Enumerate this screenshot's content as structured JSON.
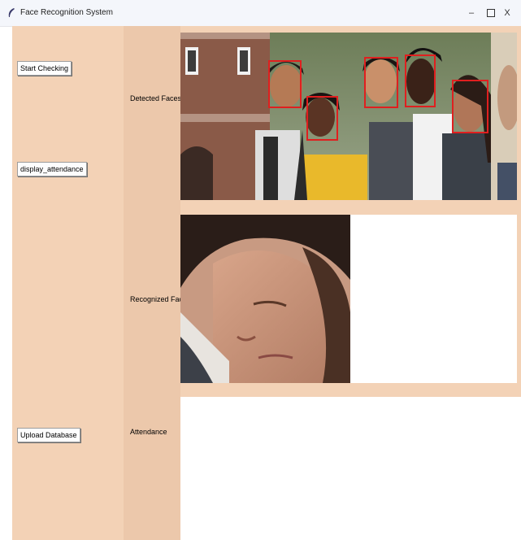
{
  "window": {
    "title": "Face Recognition System",
    "icon": "feather-icon",
    "controls": {
      "minimize_label": "–",
      "close_label": "X"
    }
  },
  "left_panel": {
    "buttons": {
      "start_checking": "Start Checking",
      "display_attendance": "display_attendance",
      "upload_database": "Upload Database"
    }
  },
  "mid_panel": {
    "labels": {
      "detected": "Detected Faces",
      "recognized": "Recognized Faces",
      "attendance": "Attendance"
    }
  },
  "colors": {
    "panel_bg": "#f3d2b6",
    "label_column_bg": "#ecc8ab",
    "face_box": "#e01f1f",
    "titlebar_bg": "#f4f6fb"
  },
  "detected_faces_count": 5
}
